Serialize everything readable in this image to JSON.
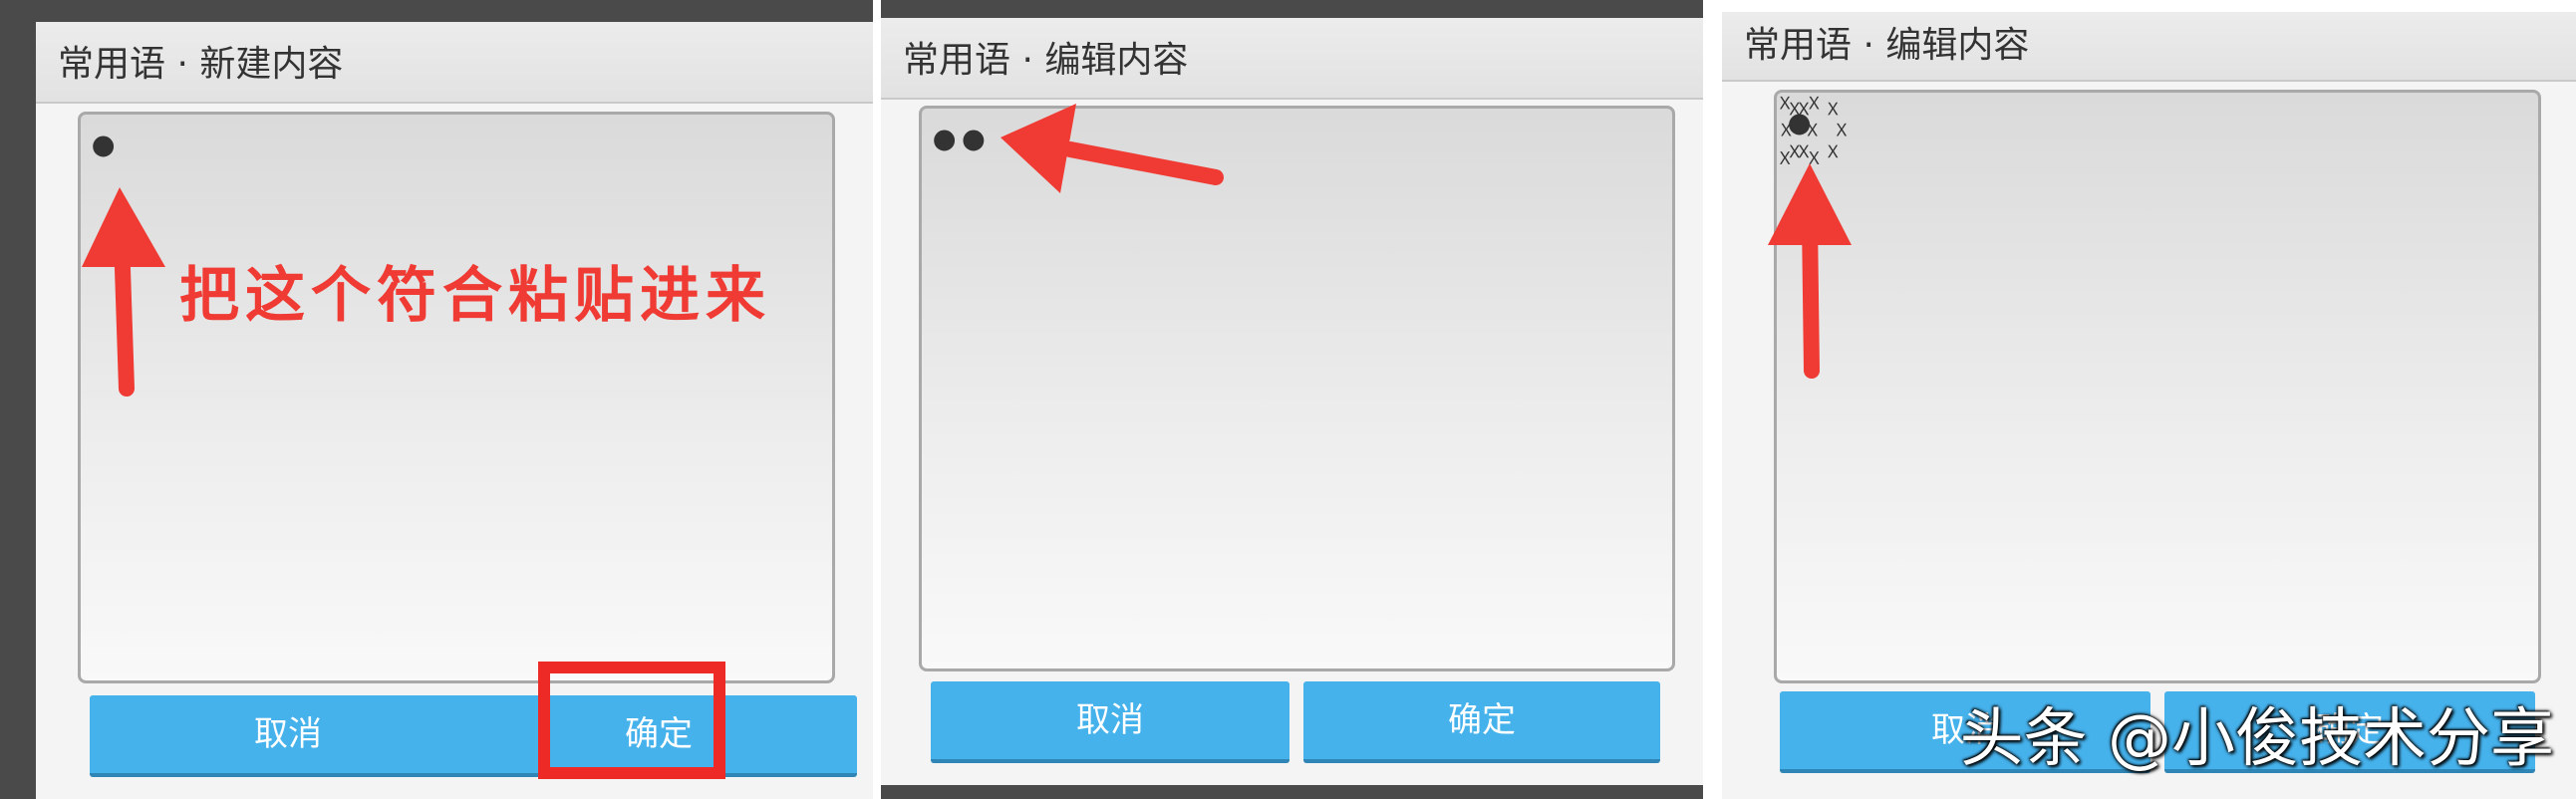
{
  "panels": [
    {
      "dialog_title": "常用语 · 新建内容",
      "content": "ꔷ",
      "cancel_label": "取消",
      "confirm_label": "确定",
      "annotation": "把这个符合粘贴进来"
    },
    {
      "dialog_title": "常用语 · 编辑内容",
      "content": "ꔷꔷ",
      "cancel_label": "取消",
      "confirm_label": "确定"
    },
    {
      "dialog_title": "常用语 · 编辑内容",
      "content": "꙰ꔷ꙰",
      "cancel_label": "取消",
      "confirm_label": "确定"
    }
  ],
  "watermark": "头条 @小俊技术分享",
  "colors": {
    "button_blue": "#46b2ec",
    "annotation_red": "#ef3b33",
    "dialog_background": "#f4f4f4"
  }
}
